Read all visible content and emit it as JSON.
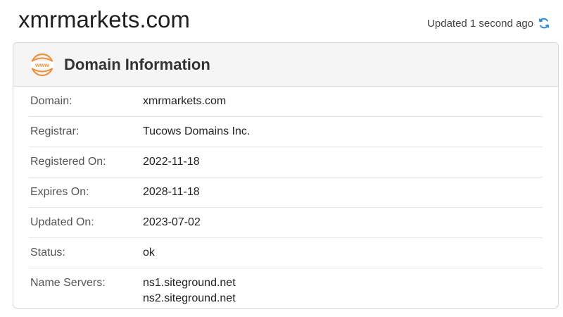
{
  "header": {
    "domain_title": "xmrmarkets.com",
    "updated_text": "Updated 1 second ago",
    "refresh_icon": "refresh-icon"
  },
  "card": {
    "icon": "www-icon",
    "title": "Domain Information",
    "rows": [
      {
        "label": "Domain:",
        "value": "xmrmarkets.com"
      },
      {
        "label": "Registrar:",
        "value": "Tucows Domains Inc."
      },
      {
        "label": "Registered On:",
        "value": "2022-11-18"
      },
      {
        "label": "Expires On:",
        "value": "2028-11-18"
      },
      {
        "label": "Updated On:",
        "value": "2023-07-02"
      },
      {
        "label": "Status:",
        "value": "ok"
      }
    ],
    "name_servers": {
      "label": "Name Servers:",
      "values": [
        "ns1.siteground.net",
        "ns2.siteground.net"
      ]
    }
  },
  "colors": {
    "accent_orange": "#f0913a",
    "refresh_blue": "#2a8fd8"
  }
}
